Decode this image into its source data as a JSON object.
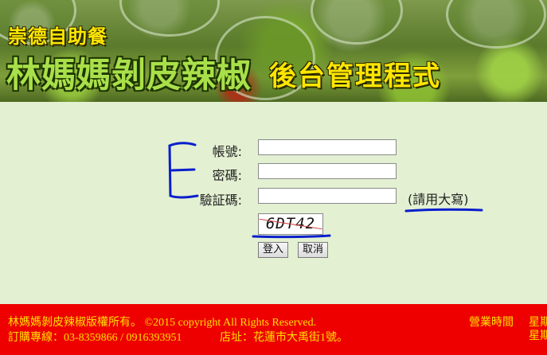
{
  "header": {
    "brand_small": "崇德自助餐",
    "brand_big": "林媽媽剝皮辣椒",
    "brand_sub": "後台管理程式"
  },
  "login_form": {
    "account_label": "帳號:",
    "account_value": "",
    "password_label": "密碼:",
    "password_value": "",
    "captcha_label": "驗証碼:",
    "captcha_value": "",
    "captcha_hint": "(請用大寫)",
    "captcha_text": "6DT42",
    "login_button": "登入",
    "cancel_button": "取消"
  },
  "footer": {
    "copyright": "林媽媽剝皮辣椒版權所有。 ©2015 copyright All Rights Reserved.",
    "order_line": "訂購專線：03-8359866 / 0916393951",
    "address": "店址：花蓮市大禹街1號。",
    "hours_label": "營業時間",
    "week_1": "星期",
    "week_2": "星期"
  },
  "colors": {
    "form_background": "#e3f0d2",
    "footer_background": "#ee0000",
    "footer_text": "#ffe000",
    "annotation_ink": "#0a1ecc",
    "brand_green": "#a9e04a",
    "brand_yellow": "#ffe600"
  }
}
